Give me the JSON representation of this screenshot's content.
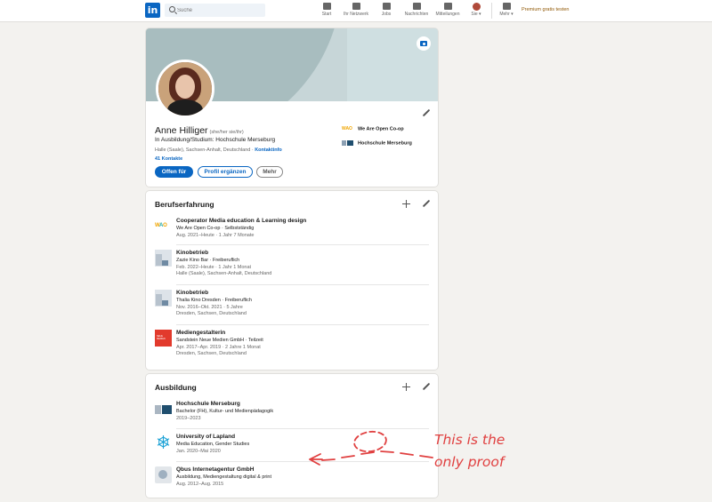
{
  "nav": {
    "logo": "in",
    "search_placeholder": "Suche",
    "items": [
      {
        "label": "Start",
        "icon": "home-icon"
      },
      {
        "label": "Ihr Netzwerk",
        "icon": "network-icon"
      },
      {
        "label": "Jobs",
        "icon": "briefcase-icon"
      },
      {
        "label": "Nachrichten",
        "icon": "message-icon"
      },
      {
        "label": "Mitteilungen",
        "icon": "bell-icon"
      },
      {
        "label": "Sie ▾",
        "icon": "avatar"
      },
      {
        "label": "Mehr ▾",
        "icon": "grid-icon"
      }
    ],
    "premium": "Premium gratis testen"
  },
  "profile": {
    "name": "Anne Hilliger",
    "pronouns": "(she/her sie/ihr)",
    "headline": "In Ausbildung/Studium: Hochschule Merseburg",
    "location": "Halle (Saale), Sachsen-Anhalt, Deutschland",
    "location_sep": " · ",
    "contact_link": "Kontaktinfo",
    "connections": "41 Kontakte",
    "buttons": {
      "open": "Offen für",
      "add": "Profil ergänzen",
      "more": "Mehr"
    },
    "orgs": [
      {
        "logo": "WAO",
        "name": "We Are Open Co-op"
      },
      {
        "logo": "hochschule-logo",
        "name": "Hochschule Merseburg"
      }
    ]
  },
  "experience": {
    "title": "Berufserfahrung",
    "items": [
      {
        "title": "Cooperator Media education & Learning design",
        "org": "We Are Open Co-op · Selbstständig",
        "dates": "Aug. 2021–Heute · 1 Jahr 7 Monate",
        "location": ""
      },
      {
        "title": "Kinobetrieb",
        "org": "Zazie Kino Bar · Freiberuflich",
        "dates": "Feb. 2022–Heute · 1 Jahr 1 Monat",
        "location": "Halle (Saale), Sachsen-Anhalt, Deutschland"
      },
      {
        "title": "Kinobetrieb",
        "org": "Thalia Kino Dresden · Freiberuflich",
        "dates": "Nov. 2016–Okt. 2021 · 5 Jahre",
        "location": "Dresden, Sachsen, Deutschland"
      },
      {
        "title": "Mediengestalterin",
        "org": "Sandstein Neue Medien GmbH · Teilzeit",
        "dates": "Apr. 2017–Apr. 2019 · 2 Jahre 1 Monat",
        "location": "Dresden, Sachsen, Deutschland"
      }
    ]
  },
  "education": {
    "title": "Ausbildung",
    "items": [
      {
        "title": "Hochschule Merseburg",
        "degree": "Bachelor (FH), Kultur- und Medienpädagogik",
        "dates": "2019–2023"
      },
      {
        "title": "University of Lapland",
        "degree": "Media Education, Gender Studies",
        "dates": "Jan. 2020–Mai 2020"
      },
      {
        "title": "Qbus Internetagentur GmbH",
        "degree": "Ausbildung, Mediengestaltung digital & print",
        "dates": "Aug. 2012–Aug. 2015"
      }
    ]
  },
  "annotation": {
    "line1": "This is the",
    "line2": "only proof",
    "color": "#e04040"
  },
  "colors": {
    "accent": "#0a66c2",
    "premium": "#915907"
  }
}
